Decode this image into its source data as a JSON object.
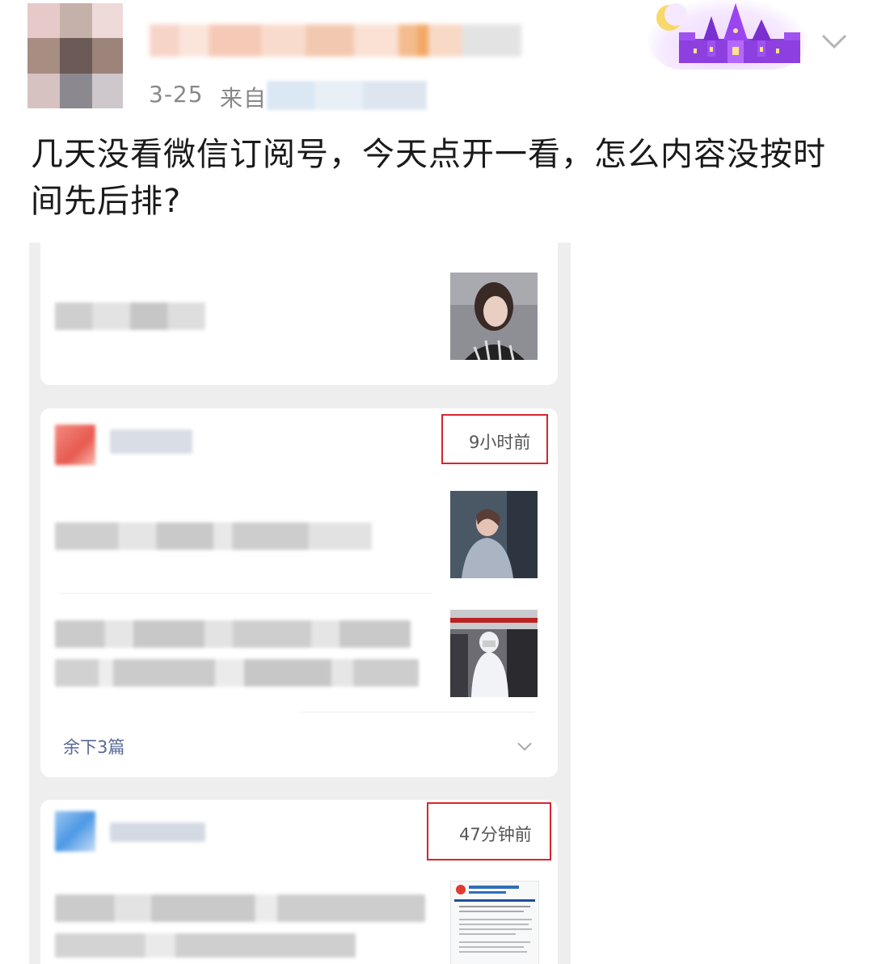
{
  "post": {
    "date": "3-25",
    "source_prefix": "来自",
    "text": "几天没看微信订阅号，今天点开一看，怎么内容没按时间先后排?"
  },
  "screenshot": {
    "card2": {
      "time": "9小时前",
      "remaining": "余下3篇"
    },
    "card3": {
      "time": "47分钟前"
    }
  },
  "colors": {
    "highlight_box": "#d7252e",
    "remaining_link": "#576b95",
    "screenshot_bg": "#eeeeee"
  }
}
